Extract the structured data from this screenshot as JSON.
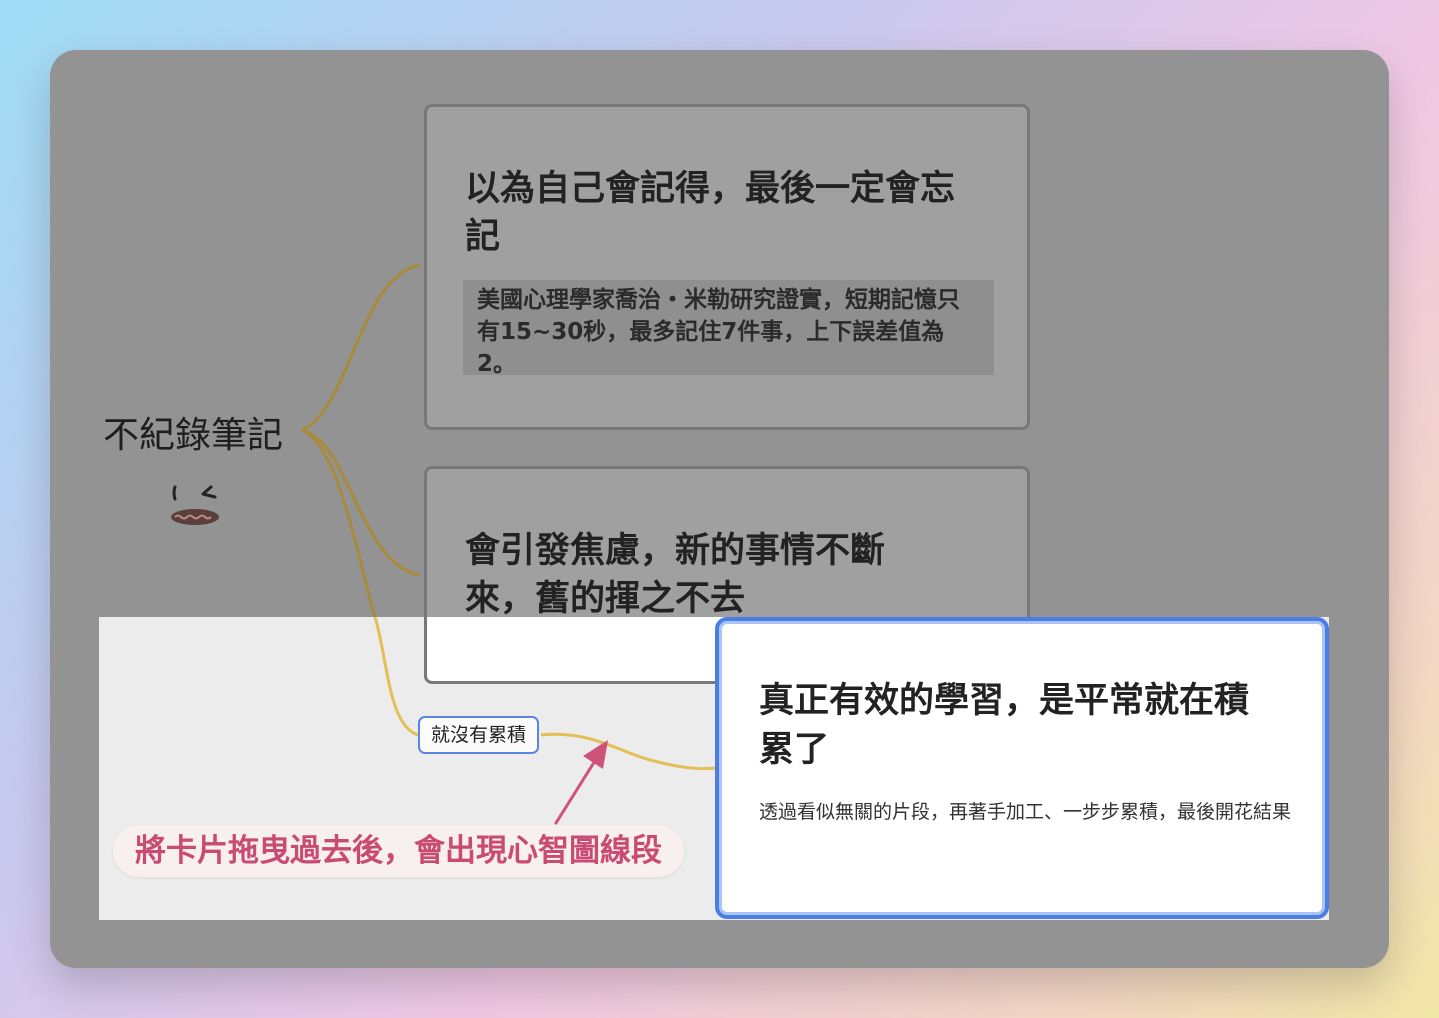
{
  "root": {
    "label": "不紀錄筆記"
  },
  "cards": [
    {
      "title": "以為自己會記得，最後一定會忘記",
      "body": "美國心理學家喬治・米勒研究證實，短期記憶只有15~30秒，最多記住7件事，上下誤差值為2。"
    },
    {
      "title": "會引發焦慮，新的事情不斷來，舊的揮之不去"
    }
  ],
  "link_node": {
    "label": "就沒有累積"
  },
  "focus_card": {
    "title": "真正有效的學習，是平常就在積累了",
    "body": "透過看似無關的片段，再著手加工、一步步累積，最後開花結果"
  },
  "callout": {
    "text": "將卡片拖曳過去後，會出現心智圖線段"
  },
  "colors": {
    "branch_dim": "#a88a3a",
    "branch_active": "#e3bf55",
    "focus_border": "#4b7ee3",
    "callout_text": "#c94a73",
    "arrow": "#cf5277"
  }
}
